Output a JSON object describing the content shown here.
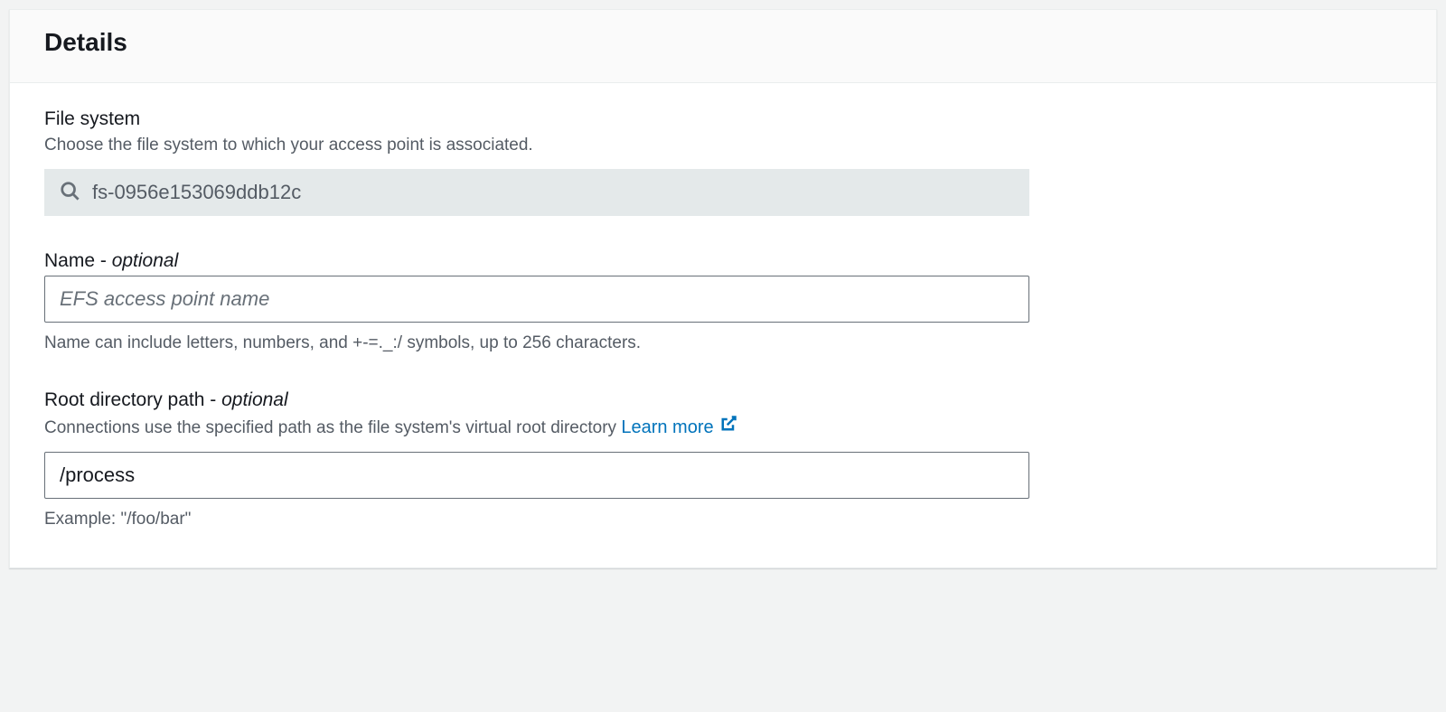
{
  "panel": {
    "title": "Details"
  },
  "fileSystem": {
    "label": "File system",
    "description": "Choose the file system to which your access point is associated.",
    "value": "fs-0956e153069ddb12c"
  },
  "name": {
    "label": "Name - ",
    "optional": "optional",
    "placeholder": "EFS access point name",
    "value": "",
    "help": "Name can include letters, numbers, and +-=._:/ symbols, up to 256 characters."
  },
  "rootPath": {
    "label": "Root directory path - ",
    "optional": "optional",
    "description": "Connections use the specified path as the file system's virtual root directory ",
    "learnMore": "Learn more",
    "value": "/process",
    "help": "Example: \"/foo/bar\""
  }
}
